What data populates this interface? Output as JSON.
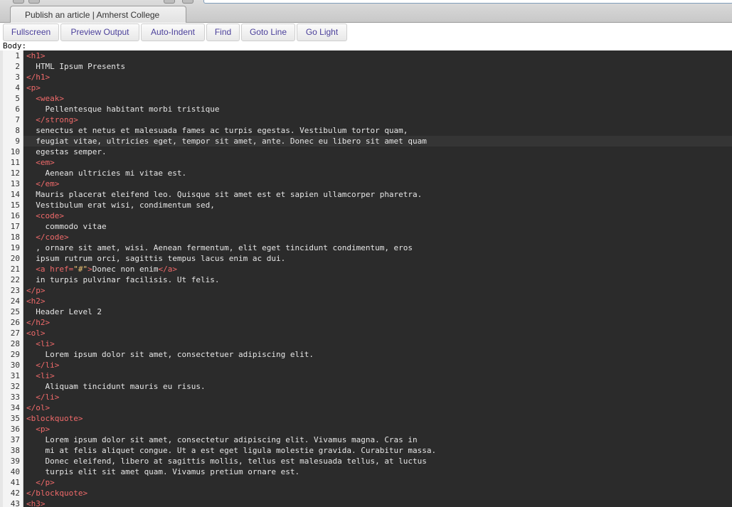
{
  "browser": {
    "tab_title": "Publish an article | Amherst College"
  },
  "toolbar": {
    "buttons": [
      "Fullscreen",
      "Preview Output",
      "Auto-Indent",
      "Find",
      "Goto Line",
      "Go Light"
    ]
  },
  "field_label": "Body:",
  "editor": {
    "active_line": 9,
    "colors": {
      "background": "#2b2b2b",
      "tag": "#f06a6a",
      "text": "#e6e6e6",
      "gutter": "#f4f4f4"
    },
    "lines": [
      "<h1>",
      "  HTML Ipsum Presents",
      "</h1>",
      "<p>",
      "  <weak>",
      "    Pellentesque habitant morbi tristique",
      "  </strong>",
      "  senectus et netus et malesuada fames ac turpis egestas. Vestibulum tortor quam,",
      "  feugiat vitae, ultricies eget, tempor sit amet, ante. Donec eu libero sit amet quam",
      "  egestas semper.",
      "  <em>",
      "    Aenean ultricies mi vitae est.",
      "  </em>",
      "  Mauris placerat eleifend leo. Quisque sit amet est et sapien ullamcorper pharetra.",
      "  Vestibulum erat wisi, condimentum sed,",
      "  <code>",
      "    commodo vitae",
      "  </code>",
      "  , ornare sit amet, wisi. Aenean fermentum, elit eget tincidunt condimentum, eros",
      "  ipsum rutrum orci, sagittis tempus lacus enim ac dui.",
      "  <a href=\"#\">Donec non enim</a>",
      "  in turpis pulvinar facilisis. Ut felis.",
      "</p>",
      "<h2>",
      "  Header Level 2",
      "</h2>",
      "<ol>",
      "  <li>",
      "    Lorem ipsum dolor sit amet, consectetuer adipiscing elit.",
      "  </li>",
      "  <li>",
      "    Aliquam tincidunt mauris eu risus.",
      "  </li>",
      "</ol>",
      "<blockquote>",
      "  <p>",
      "    Lorem ipsum dolor sit amet, consectetur adipiscing elit. Vivamus magna. Cras in",
      "    mi at felis aliquet congue. Ut a est eget ligula molestie gravida. Curabitur massa.",
      "    Donec eleifend, libero at sagittis mollis, tellus est malesuada tellus, at luctus",
      "    turpis elit sit amet quam. Vivamus pretium ornare est.",
      "  </p>",
      "</blockquote>",
      "<h3>"
    ]
  }
}
